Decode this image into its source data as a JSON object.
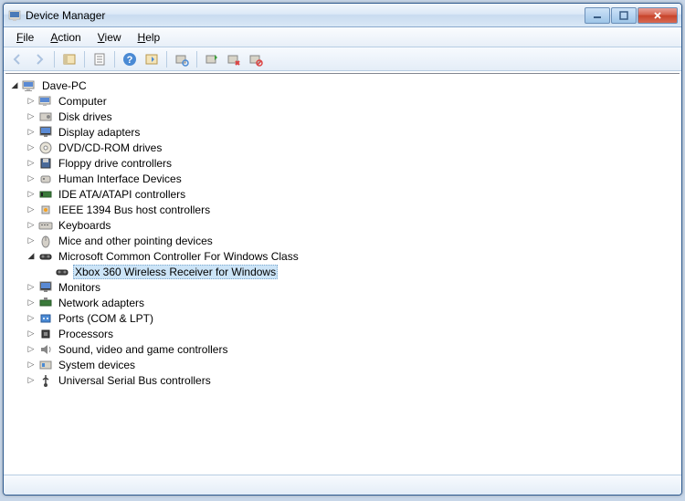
{
  "window": {
    "title": "Device Manager"
  },
  "menu": {
    "file": "File",
    "action": "Action",
    "view": "View",
    "help": "Help"
  },
  "toolbar": {
    "back": "back-icon",
    "forward": "forward-icon",
    "folder_up": "show-hide-icon",
    "properties": "properties-icon",
    "help": "help-icon",
    "refresh": "refresh-icon",
    "scan": "scan-icon",
    "update": "update-driver-icon",
    "uninstall": "uninstall-icon",
    "disable": "disable-icon"
  },
  "tree": {
    "root": {
      "label": "Dave-PC",
      "expanded": true
    },
    "categories": [
      {
        "label": "Computer",
        "icon": "computer-icon",
        "expanded": false
      },
      {
        "label": "Disk drives",
        "icon": "disk-icon",
        "expanded": false
      },
      {
        "label": "Display adapters",
        "icon": "display-icon",
        "expanded": false
      },
      {
        "label": "DVD/CD-ROM drives",
        "icon": "dvd-icon",
        "expanded": false
      },
      {
        "label": "Floppy drive controllers",
        "icon": "floppy-icon",
        "expanded": false
      },
      {
        "label": "Human Interface Devices",
        "icon": "hid-icon",
        "expanded": false
      },
      {
        "label": "IDE ATA/ATAPI controllers",
        "icon": "ide-icon",
        "expanded": false
      },
      {
        "label": "IEEE 1394 Bus host controllers",
        "icon": "ieee-icon",
        "expanded": false
      },
      {
        "label": "Keyboards",
        "icon": "keyboard-icon",
        "expanded": false
      },
      {
        "label": "Mice and other pointing devices",
        "icon": "mouse-icon",
        "expanded": false
      },
      {
        "label": "Microsoft Common Controller For Windows Class",
        "icon": "controller-icon",
        "expanded": true,
        "children": [
          {
            "label": "Xbox 360 Wireless Receiver for Windows",
            "icon": "xbox-icon",
            "selected": true
          }
        ]
      },
      {
        "label": "Monitors",
        "icon": "monitor-icon",
        "expanded": false
      },
      {
        "label": "Network adapters",
        "icon": "network-icon",
        "expanded": false
      },
      {
        "label": "Ports (COM & LPT)",
        "icon": "port-icon",
        "expanded": false
      },
      {
        "label": "Processors",
        "icon": "cpu-icon",
        "expanded": false
      },
      {
        "label": "Sound, video and game controllers",
        "icon": "sound-icon",
        "expanded": false
      },
      {
        "label": "System devices",
        "icon": "system-icon",
        "expanded": false
      },
      {
        "label": "Universal Serial Bus controllers",
        "icon": "usb-icon",
        "expanded": false
      }
    ]
  }
}
